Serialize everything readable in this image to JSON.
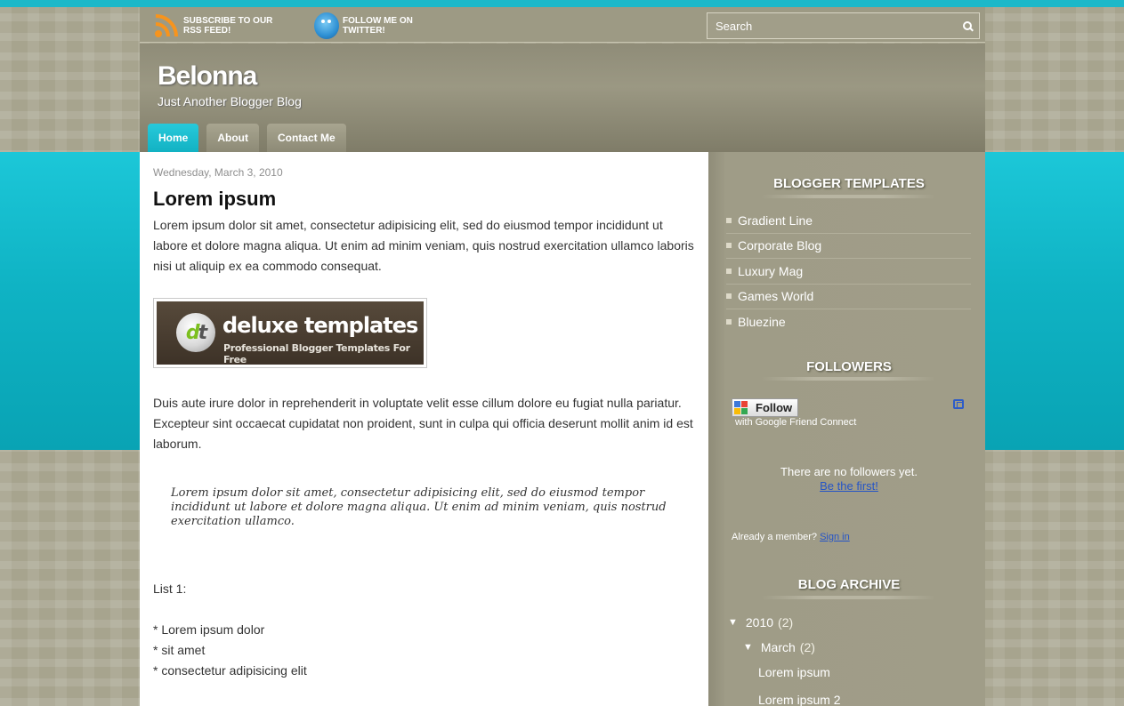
{
  "topbar": {
    "rss_label": "SUBSCRIBE TO OUR RSS FEED!",
    "twitter_label": "FOLLOW ME ON TWITTER!",
    "search_placeholder": "Search"
  },
  "header": {
    "title": "Belonna",
    "description": "Just Another Blogger Blog"
  },
  "nav": [
    {
      "label": "Home",
      "active": true
    },
    {
      "label": "About",
      "active": false
    },
    {
      "label": "Contact Me",
      "active": false
    }
  ],
  "post": {
    "date": "Wednesday, March 3, 2010",
    "title": "Lorem ipsum",
    "para1": "Lorem ipsum dolor sit amet, consectetur adipisicing elit, sed do eiusmod tempor incididunt ut labore et dolore magna aliqua. Ut enim ad minim veniam, quis nostrud exercitation ullamco laboris nisi ut aliquip ex ea commodo consequat.",
    "banner": {
      "logo_d": "d",
      "logo_t": "t",
      "title": "deluxe templates",
      "subtitle": "Professional Blogger Templates For Free"
    },
    "para2": "Duis aute irure dolor in reprehenderit in voluptate velit esse cillum dolore eu fugiat nulla pariatur. Excepteur sint occaecat cupidatat non proident, sunt in culpa qui officia deserunt mollit anim id est laborum.",
    "quote": "Lorem ipsum dolor sit amet, consectetur adipisicing elit, sed do eiusmod tempor incididunt ut labore et dolore magna aliqua. Ut enim ad minim veniam, quis nostrud exercitation ullamco.",
    "list_title": "List 1:",
    "list_items": [
      "* Lorem ipsum dolor",
      "* sit amet",
      "* consectetur adipisicing elit"
    ]
  },
  "sidebar": {
    "templates_title": "BLOGGER TEMPLATES",
    "templates": [
      "Gradient Line",
      "Corporate Blog",
      "Luxury Mag",
      "Games World",
      "Bluezine"
    ],
    "followers_title": "FOLLOWERS",
    "follow_button": "Follow",
    "follow_sub": "with Google Friend Connect",
    "no_followers": "There are no followers yet.",
    "be_first": "Be the first!",
    "already_member": "Already a member?",
    "sign_in": "Sign in",
    "archive_title": "BLOG ARCHIVE",
    "archive": {
      "year": "2010",
      "year_count": "(2)",
      "month": "March",
      "month_count": "(2)",
      "posts": [
        "Lorem ipsum",
        "Lorem ipsum 2"
      ]
    }
  },
  "colors": {
    "accent": "#1cb8c9",
    "link": "#2554c7",
    "background": "#a7a48e"
  }
}
